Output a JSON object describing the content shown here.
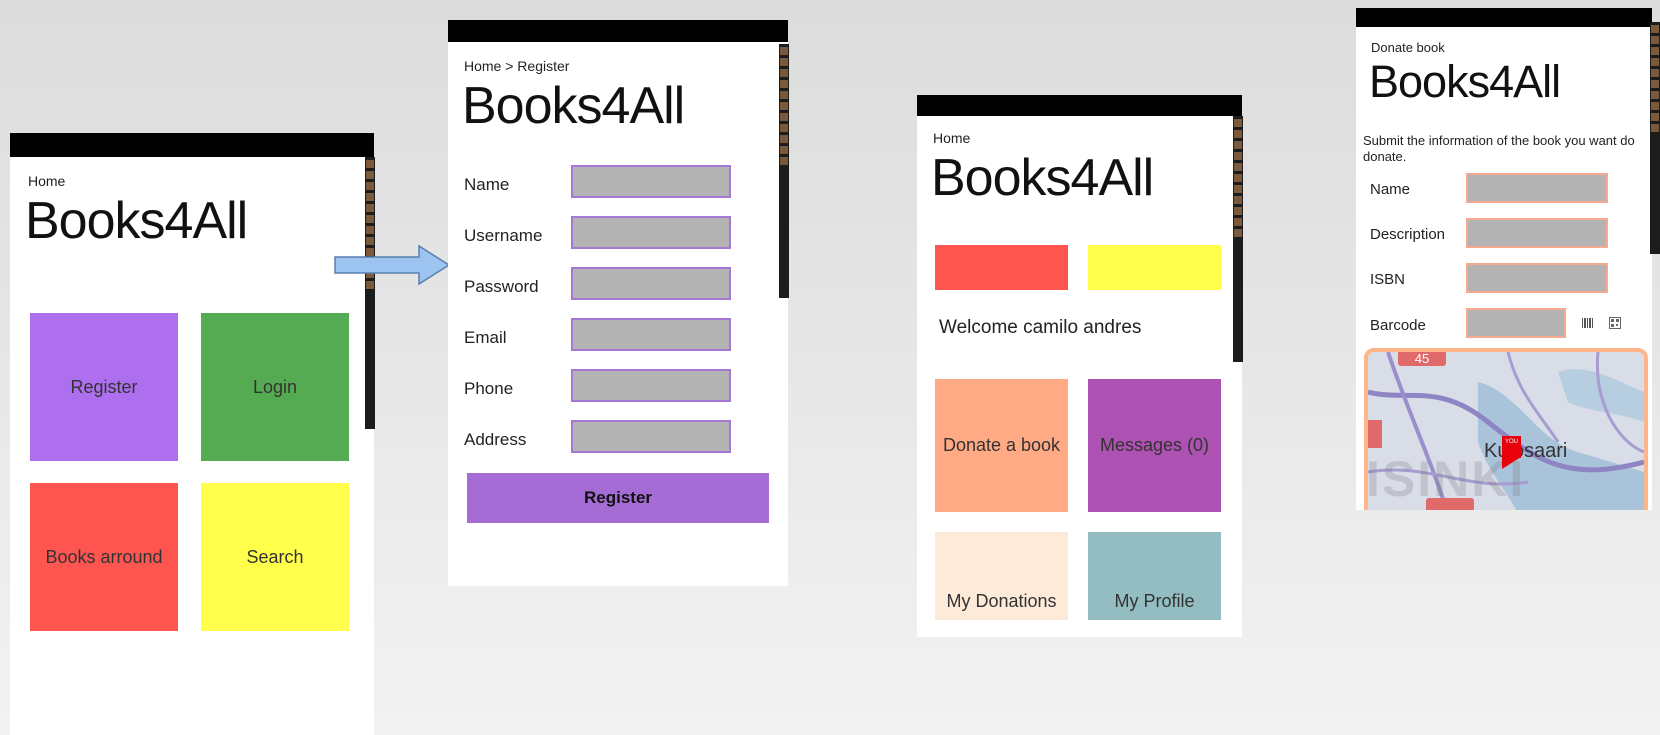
{
  "app_title": "Books4All",
  "home_screen": {
    "breadcrumb": "Home",
    "tiles": [
      {
        "label": "Register",
        "color": "#ae6fee"
      },
      {
        "label": "Login",
        "color": "#54ab51"
      },
      {
        "label": "Books arround",
        "color": "#ff5550"
      },
      {
        "label": "Search",
        "color": "#ffff4c"
      }
    ]
  },
  "register_screen": {
    "breadcrumb": "Home > Register",
    "fields": [
      "Name",
      "Username",
      "Password",
      "Email",
      "Phone",
      "Address"
    ],
    "button_label": "Register",
    "button_color": "#a46cd4",
    "input_border_color": "#a678d6"
  },
  "dashboard_screen": {
    "breadcrumb": "Home",
    "banner_colors": [
      "#ff5550",
      "#ffff4c"
    ],
    "welcome": "Welcome camilo andres",
    "tiles": [
      {
        "label": "Donate a book",
        "color": "#ffa985"
      },
      {
        "label": "Messages (0)",
        "color": "#ad51b2"
      },
      {
        "label": "My Donations",
        "color": "#feead8"
      },
      {
        "label": "My Profile",
        "color": "#93bdc0"
      }
    ]
  },
  "donate_screen": {
    "breadcrumb": "Donate book",
    "intro": "Submit the information of the book you want do donate.",
    "fields": [
      "Name",
      "Description",
      "ISBN",
      "Barcode"
    ],
    "input_border_color": "#f5a98e",
    "barcode_icon": "barcode-icon",
    "qr_icon": "qr-code-icon",
    "map": {
      "place_label": "Kulosaari",
      "watermark": "ISINKI",
      "pin_label": "YOU",
      "badge": "45",
      "border_color": "#ffb48a"
    }
  },
  "flow_arrow_color": "#9dc3f0"
}
